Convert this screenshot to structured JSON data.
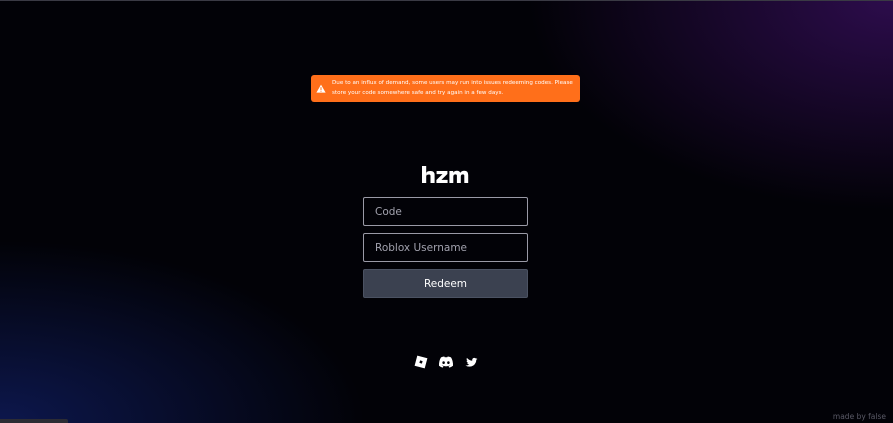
{
  "alert": {
    "icon": "warning-triangle-icon",
    "message": "Due to an influx of demand, some users may run into issues redeeming codes. Please store your code somewhere safe and try again in a few days.",
    "color": "#ff6f1a"
  },
  "brand": {
    "logo_text": "hzm"
  },
  "form": {
    "code_placeholder": "Code",
    "code_value": "",
    "username_placeholder": "Roblox Username",
    "username_value": "",
    "redeem_label": "Redeem"
  },
  "social": [
    {
      "icon": "roblox-icon"
    },
    {
      "icon": "discord-icon"
    },
    {
      "icon": "twitter-icon"
    }
  ],
  "footer": {
    "credit": "made by false"
  }
}
